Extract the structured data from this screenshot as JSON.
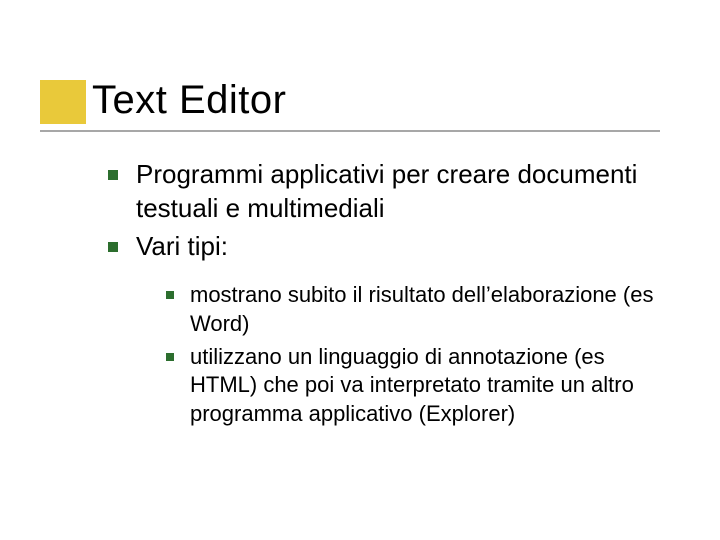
{
  "slide": {
    "title": "Text Editor",
    "bullets": [
      {
        "text": "Programmi applicativi per creare documenti testuali e multimediali"
      },
      {
        "text": "Vari tipi:"
      }
    ],
    "subbullets": [
      {
        "text": "mostrano subito il risultato dell’elaborazione (es Word)"
      },
      {
        "text": "utilizzano un linguaggio di annotazione (es HTML) che poi va interpretato tramite un altro programma applicativo (Explorer)"
      }
    ]
  }
}
